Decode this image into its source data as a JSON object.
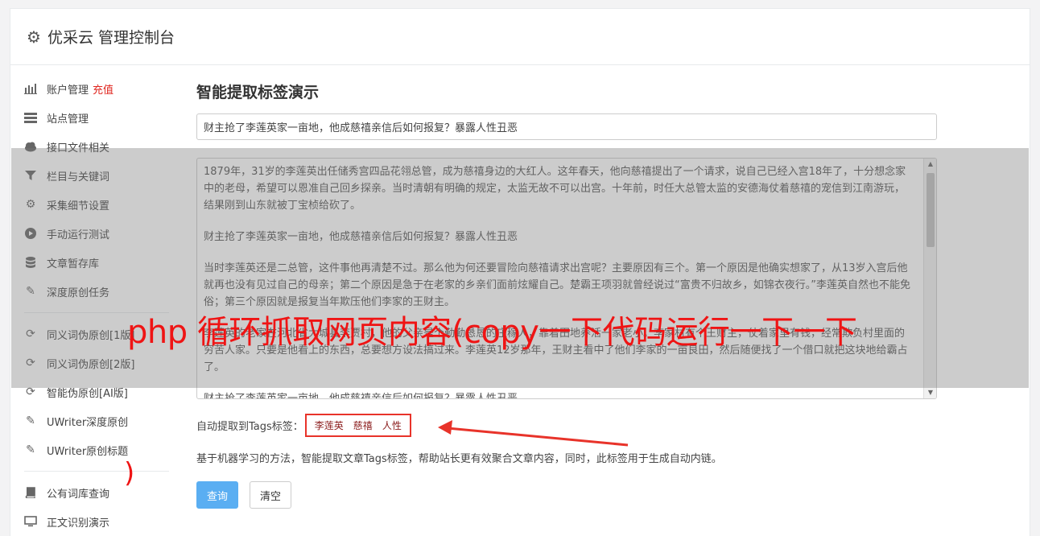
{
  "header": {
    "title": "优采云 管理控制台",
    "icon": "gear-icon"
  },
  "sidebar": {
    "items": [
      {
        "label": "账户管理",
        "badge": "充值",
        "icon": "bar-chart-icon"
      },
      {
        "label": "站点管理",
        "icon": "server-icon"
      },
      {
        "label": "接口文件相关",
        "icon": "cloud-upload-icon"
      },
      {
        "label": "栏目与关键词",
        "icon": "filter-icon"
      },
      {
        "label": "采集细节设置",
        "icon": "gears-icon"
      },
      {
        "label": "手动运行测试",
        "icon": "play-circle-icon"
      },
      {
        "label": "文章暂存库",
        "icon": "database-icon"
      },
      {
        "label": "深度原创任务",
        "icon": "edit-icon"
      },
      {
        "label": "同义词伪原创[1版]",
        "icon": "refresh-icon"
      },
      {
        "label": "同义词伪原创[2版]",
        "icon": "refresh-icon"
      },
      {
        "label": "智能伪原创[AI版]",
        "icon": "refresh-icon"
      },
      {
        "label": "UWriter深度原创",
        "icon": "edit-icon"
      },
      {
        "label": "UWriter原创标题",
        "icon": "edit-icon"
      },
      {
        "label": "公有词库查询",
        "icon": "book-icon"
      },
      {
        "label": "正文识别演示",
        "icon": "monitor-icon"
      }
    ]
  },
  "main": {
    "title": "智能提取标签演示",
    "title_input": "财主抢了李莲英家一亩地，他成慈禧亲信后如何报复？暴露人性丑恶",
    "paragraphs": [
      "1879年，31岁的李莲英出任储秀宫四品花翎总管，成为慈禧身边的大红人。这年春天，他向慈禧提出了一个请求，说自己已经入宫18年了，十分想念家中的老母，希望可以恩准自己回乡探亲。当时清朝有明确的规定，太监无故不可以出宫。十年前，时任大总管太监的安德海仗着慈禧的宠信到江南游玩，结果刚到山东就被丁宝桢给砍了。",
      "财主抢了李莲英家一亩地，他成慈禧亲信后如何报复？暴露人性丑恶",
      "当时李莲英还是二总管，这件事他再清楚不过。那么他为何还要冒险向慈禧请求出宫呢？主要原因有三个。第一个原因是他确实想家了，从13岁入宫后他就再也没有见过自己的母亲；第二个原因是急于在老家的乡亲们面前炫耀自己。楚霸王项羽就曾经说过“富贵不归故乡，如锦衣夜行。”李莲英自然也不能免俗；第三个原因就是报复当年欺压他们李家的王财主。",
      "李莲英的老家在河北省大城县李贾村，他的父亲是个勤勤恳恳的庄稼人，靠着田地养活一家老小。李家村有个王财主，仗着家里有钱，经常欺负村里面的穷苦人家。只要是他看上的东西，总要想方设法搞过来。李莲英12岁那年，王财主看中了他们李家的一亩良田，然后随便找了一个借口就把这块地给霸占了。",
      "财主抢了李莲英家一亩地，他成慈禧亲信后如何报复？暴露人性丑恶"
    ],
    "tags_label": "自动提取到Tags标签：",
    "tags": [
      "李莲英",
      "慈禧",
      "人性"
    ],
    "description": "基于机器学习的方法，智能提取文章Tags标签，帮助站长更有效聚合文章内容，同时，此标签用于生成自动内链。",
    "query_button": "查询",
    "clear_button": "清空"
  },
  "overlay": {
    "caption": "php 循环抓取网页内容(copy一下代码运行一下一下",
    "paren": ")"
  },
  "colors": {
    "accent": "#5aaef2",
    "overlay_red": "#ef1414",
    "badge_red": "#e0261f"
  }
}
